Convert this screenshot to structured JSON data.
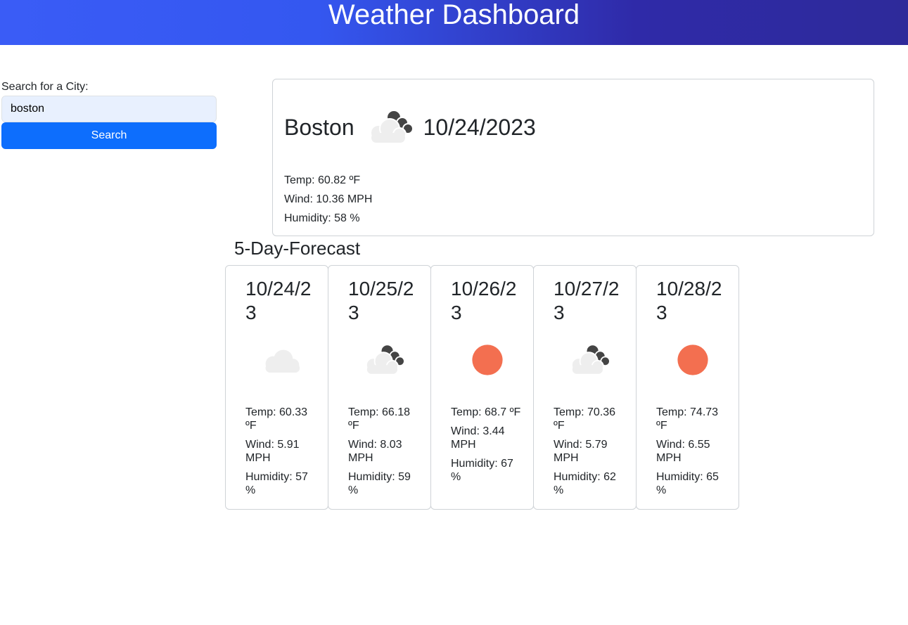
{
  "header": {
    "title": "Weather Dashboard"
  },
  "search": {
    "label": "Search for a City:",
    "value": "boston",
    "button_label": "Search"
  },
  "current": {
    "city": "Boston",
    "date": "10/24/2023",
    "icon": "cloudy-night-icon",
    "temp": "Temp: 60.82 ºF",
    "wind": "Wind: 10.36 MPH",
    "humidity": "Humidity: 58 %"
  },
  "forecast": {
    "title": "5-Day-Forecast",
    "days": [
      {
        "date": "10/24/23",
        "icon": "cloud-icon",
        "temp": "Temp: 60.33 ºF",
        "wind": "Wind: 5.91 MPH",
        "humidity": "Humidity: 57 %"
      },
      {
        "date": "10/25/23",
        "icon": "cloudy-night-icon",
        "temp": "Temp: 66.18 ºF",
        "wind": "Wind: 8.03 MPH",
        "humidity": "Humidity: 59 %"
      },
      {
        "date": "10/26/23",
        "icon": "sun-icon",
        "temp": "Temp: 68.7 ºF",
        "wind": "Wind: 3.44 MPH",
        "humidity": "Humidity: 67 %"
      },
      {
        "date": "10/27/23",
        "icon": "cloudy-night-icon",
        "temp": "Temp: 70.36 ºF",
        "wind": "Wind: 5.79 MPH",
        "humidity": "Humidity: 62 %"
      },
      {
        "date": "10/28/23",
        "icon": "sun-icon",
        "temp": "Temp: 74.73 ºF",
        "wind": "Wind: 6.55 MPH",
        "humidity": "Humidity: 65 %"
      }
    ]
  },
  "colors": {
    "header_start": "#3a5cf6",
    "header_end": "#2e2a9a",
    "button": "#0d6efd",
    "input_bg": "#e8f0fe",
    "sun": "#f36f50",
    "cloud": "#eeeeee",
    "dark_cloud": "#444444"
  }
}
